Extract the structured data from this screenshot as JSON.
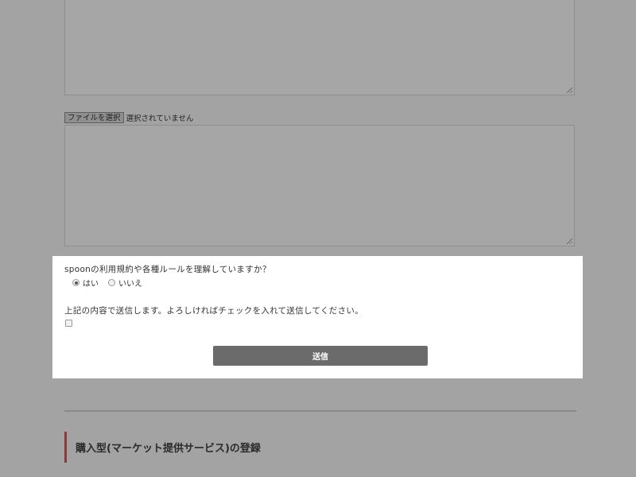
{
  "file_input": {
    "button_label": "ファイルを選択",
    "status_text": "選択されていません"
  },
  "modal": {
    "question1": "spoonの利用規約や各種ルールを理解していますか？",
    "radio_options": [
      {
        "label": "はい",
        "checked": true
      },
      {
        "label": "いいえ",
        "checked": false
      }
    ],
    "question2": "上記の内容で送信します。よろしければチェックを入れて送信してください。",
    "checkbox_checked": false,
    "submit_label": "送信"
  },
  "section": {
    "heading": "購入型(マーケット提供サービス)の登録"
  },
  "colors": {
    "overlay_background": "#a3a3a3",
    "modal_background": "#ffffff",
    "submit_button": "#6b6b6b",
    "heading_accent": "#8b3a3a"
  }
}
